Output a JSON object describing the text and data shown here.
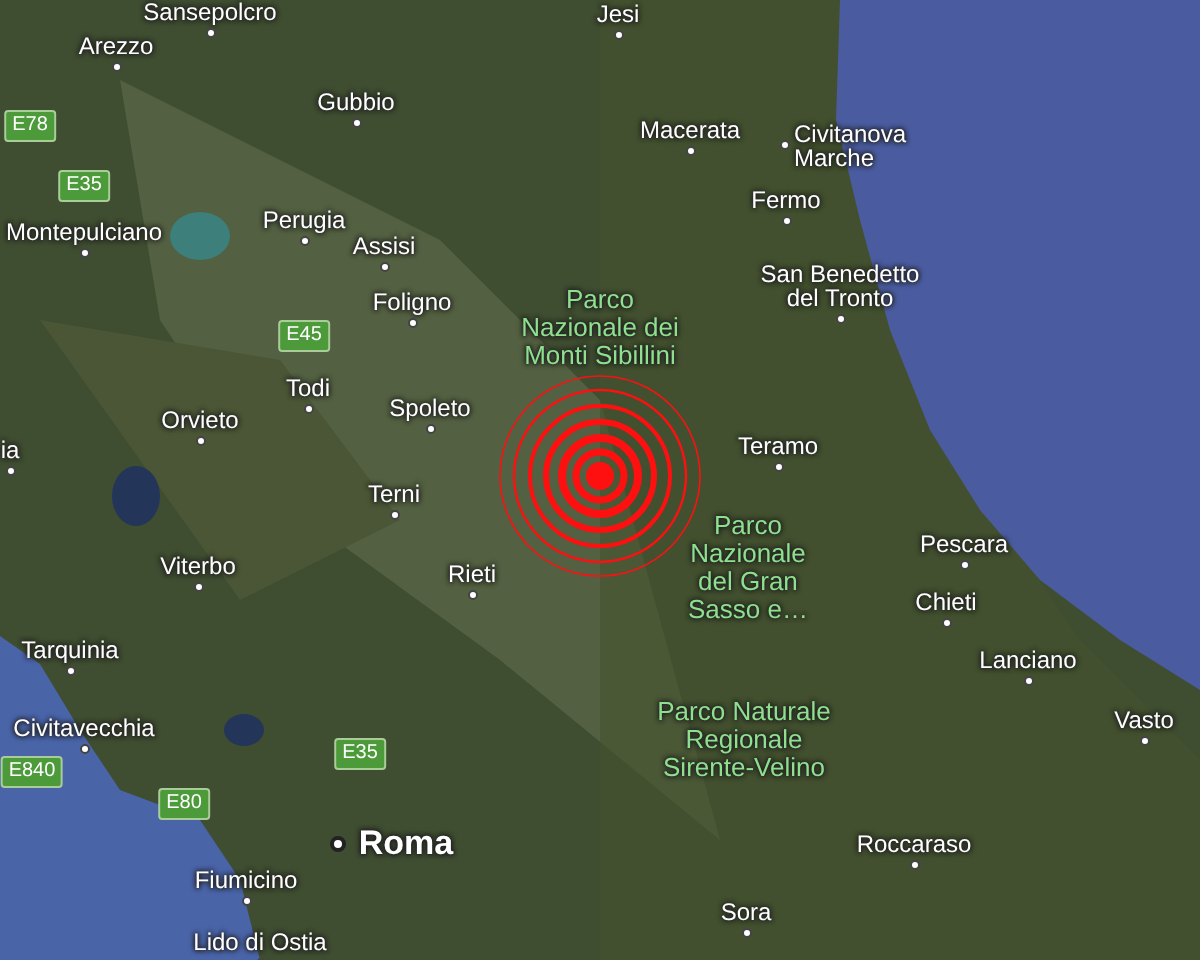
{
  "map": {
    "places": [
      {
        "kind": "city",
        "name": "Sansepolcro"
      },
      {
        "kind": "city",
        "name": "Jesi"
      },
      {
        "kind": "city",
        "name": "Arezzo"
      },
      {
        "kind": "road",
        "name": "E78"
      },
      {
        "kind": "city",
        "name": "Gubbio"
      },
      {
        "kind": "road",
        "name": "E35"
      },
      {
        "kind": "city",
        "name": "Montepulciano"
      },
      {
        "kind": "city",
        "name": "Perugia"
      },
      {
        "kind": "city",
        "name": "Assisi"
      },
      {
        "kind": "city",
        "name": "Foligno"
      },
      {
        "kind": "road",
        "name": "E45"
      },
      {
        "kind": "city",
        "name": "Todi"
      },
      {
        "kind": "city",
        "name": "Spoleto"
      },
      {
        "kind": "city",
        "name": "Orvieto"
      },
      {
        "kind": "city",
        "name": "ia"
      },
      {
        "kind": "park",
        "lines": [
          "Parco",
          "Nazionale dei",
          "Monti Sibillini"
        ]
      },
      {
        "kind": "city",
        "name": "Macerata"
      },
      {
        "kind": "city",
        "lines": [
          "Civitanova",
          "Marche"
        ]
      },
      {
        "kind": "city",
        "name": "Fermo"
      },
      {
        "kind": "city",
        "lines": [
          "San Benedetto",
          "del Tronto"
        ]
      },
      {
        "kind": "city",
        "name": "Teramo"
      },
      {
        "kind": "city",
        "name": "Terni"
      },
      {
        "kind": "city",
        "name": "Viterbo"
      },
      {
        "kind": "city",
        "name": "Rieti"
      },
      {
        "kind": "park",
        "lines": [
          "Parco",
          "Nazionale",
          "del Gran",
          "Sasso e…"
        ]
      },
      {
        "kind": "city",
        "name": "Pescara"
      },
      {
        "kind": "city",
        "name": "Chieti"
      },
      {
        "kind": "city",
        "name": "Tarquinia"
      },
      {
        "kind": "city",
        "name": "Lanciano"
      },
      {
        "kind": "city",
        "name": "Civitavecchia"
      },
      {
        "kind": "park",
        "lines": [
          "Parco Naturale",
          "Regionale",
          "Sirente-Velino"
        ]
      },
      {
        "kind": "city",
        "name": "Vasto"
      },
      {
        "kind": "road",
        "name": "E840"
      },
      {
        "kind": "road",
        "name": "E35"
      },
      {
        "kind": "road",
        "name": "E80"
      },
      {
        "kind": "capital",
        "name": "Roma"
      },
      {
        "kind": "city",
        "name": "Roccaraso"
      },
      {
        "kind": "city",
        "name": "Fiumicino"
      },
      {
        "kind": "city",
        "name": "Sora"
      },
      {
        "kind": "city",
        "name": "Lido di Ostia"
      }
    ]
  }
}
